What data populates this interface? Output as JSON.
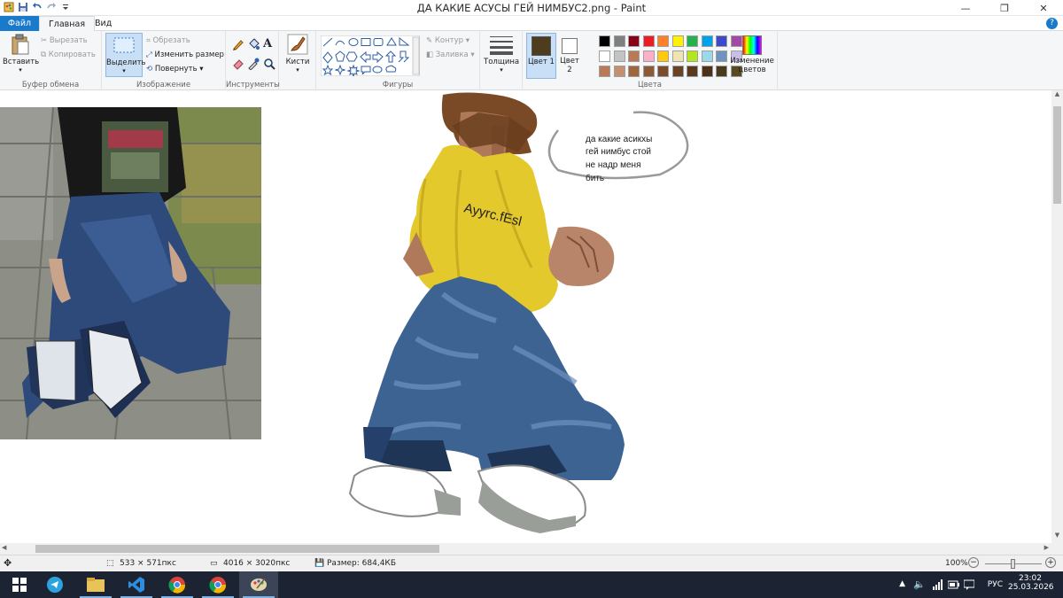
{
  "window": {
    "title": "ДА КАКИЕ АСУСЫ ГЕЙ НИМБУС2.png - Paint",
    "controls": {
      "minimize": "—",
      "restore": "❐",
      "close": "✕"
    }
  },
  "menu": {
    "file": "Файл",
    "home": "Главная",
    "view": "Вид",
    "help": "?"
  },
  "ribbon": {
    "clipboard": {
      "label": "Буфер обмена",
      "paste": "Вставить",
      "cut": "Вырезать",
      "copy": "Копировать"
    },
    "image": {
      "label": "Изображение",
      "select": "Выделить",
      "crop": "Обрезать",
      "resize": "Изменить размер",
      "rotate": "Повернуть"
    },
    "tools": {
      "label": "Инструменты"
    },
    "brushes": {
      "label": "Кисти"
    },
    "shapes": {
      "label": "Фигуры",
      "outline": "Контур",
      "fill": "Заливка"
    },
    "size": {
      "label": "Толщина"
    },
    "colors": {
      "label": "Цвета",
      "color1": "Цвет 1",
      "color2": "Цвет 2",
      "edit": "Изменение цветов",
      "color1_value": "#4d3d1e",
      "color2_value": "#ffffff",
      "palette_row1": [
        "#000000",
        "#7f7f7f",
        "#880015",
        "#ed1c24",
        "#ff7f27",
        "#fff200",
        "#22b14c",
        "#00a2e8",
        "#3f48cc",
        "#a349a4"
      ],
      "palette_row2": [
        "#ffffff",
        "#c3c3c3",
        "#b97a57",
        "#ffaec9",
        "#ffc90e",
        "#efe4b0",
        "#b5e61d",
        "#99d9ea",
        "#7092be",
        "#c8bfe7"
      ],
      "palette_row3": [
        "#b97a57",
        "#c49070",
        "#a0673f",
        "#8b5a37",
        "#7a4d2e",
        "#6a4227",
        "#5c3a22",
        "#4d3119",
        "#4a3a1e",
        "#5a4a22"
      ]
    }
  },
  "canvas": {
    "speech_text": [
      "да какие асикxы",
      "гей нимбус стой",
      "не надр меня",
      "бить"
    ],
    "shirt_text": "Ayyrc.fEsl"
  },
  "status": {
    "cursor": "",
    "selection": "533 × 571пкс",
    "dimensions": "4016 × 3020пкс",
    "filesize": "Размер: 684,4КБ",
    "zoom": "100%"
  },
  "taskbar": {
    "lang": "РУС",
    "time": "23:02",
    "date": "25.03.2026"
  }
}
